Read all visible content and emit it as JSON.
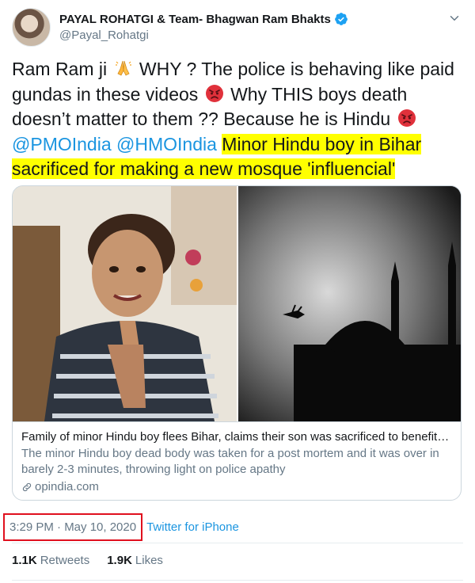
{
  "tweet": {
    "author": {
      "display_name": "PAYAL ROHATGI & Team- Bhagwan Ram Bhakts",
      "handle": "@Payal_Rohatgi",
      "verified": true
    },
    "text": {
      "part1": "Ram Ram ji",
      "part2": " WHY ? The police is behaving like paid gundas in these videos",
      "part3": " Why THIS boys death doesn’t matter to them ?? Because he is Hindu",
      "mention1": "@PMOIndia",
      "mention2": "@HMOIndia",
      "highlighted": "Minor Hindu boy in Bihar sacrificed for making a new mosque 'influencial'",
      "emoji_1": "folded-hands",
      "emoji_2": "angry-face",
      "emoji_3": "angry-face"
    },
    "card": {
      "title": "Family of minor Hindu boy flees Bihar, claims their son was sacrificed to benefit a...",
      "description": "The minor Hindu boy dead body was taken for a post mortem and it was over in barely 2-3 minutes, throwing light on police apathy",
      "domain": "opindia.com"
    },
    "timestamp": "3:29 PM · May 10, 2020",
    "source": "Twitter for iPhone",
    "stats": {
      "retweets_count": "1.1K",
      "retweets_label": "Retweets",
      "likes_count": "1.9K",
      "likes_label": "Likes"
    }
  },
  "colors": {
    "link": "#1b95e0",
    "highlight": "#ffff00",
    "annotation_box": "#e0101e",
    "secondary_text": "#657786"
  }
}
